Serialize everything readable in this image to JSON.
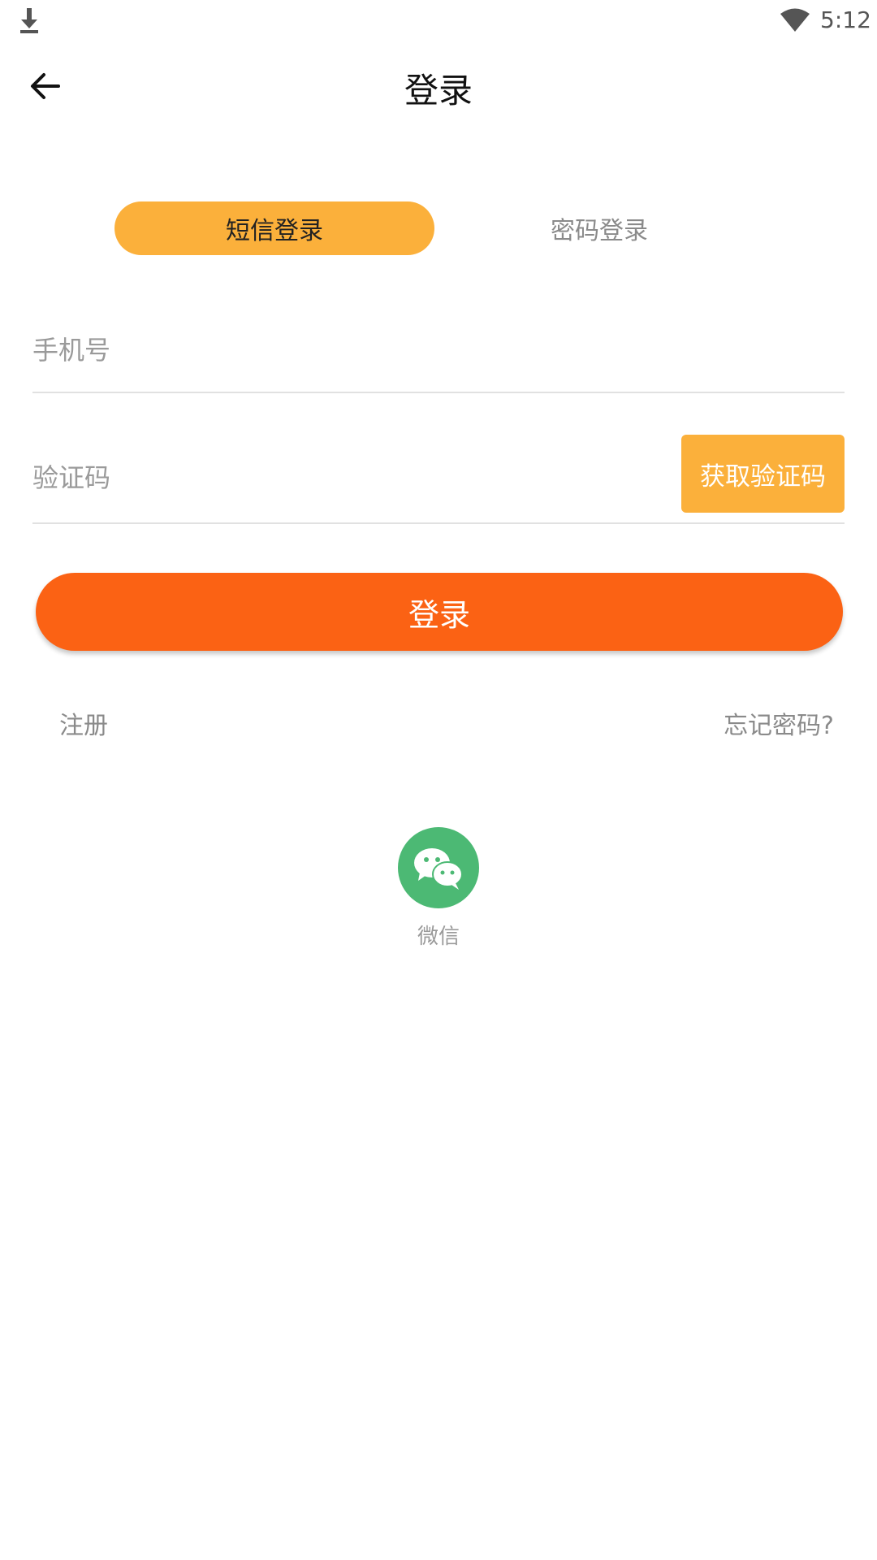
{
  "status_bar": {
    "time": "5:12",
    "download_icon": "download-icon",
    "wifi_icon": "wifi-icon"
  },
  "header": {
    "back_icon": "arrow-back-icon",
    "title": "登录"
  },
  "tabs": [
    {
      "label": "短信登录",
      "active": true
    },
    {
      "label": "密码登录",
      "active": false
    }
  ],
  "form": {
    "phone_placeholder": "手机号",
    "phone_value": "",
    "code_placeholder": "验证码",
    "code_value": "",
    "get_code_label": "获取验证码"
  },
  "login_button_label": "登录",
  "links": {
    "register": "注册",
    "forgot_password": "忘记密码?"
  },
  "social_login": {
    "wechat_icon": "wechat-icon",
    "wechat_label": "微信"
  },
  "colors": {
    "tab_active": "#fbb03b",
    "get_code_button": "#fbb03b",
    "login_button": "#fb6214",
    "wechat": "#4cb974"
  }
}
